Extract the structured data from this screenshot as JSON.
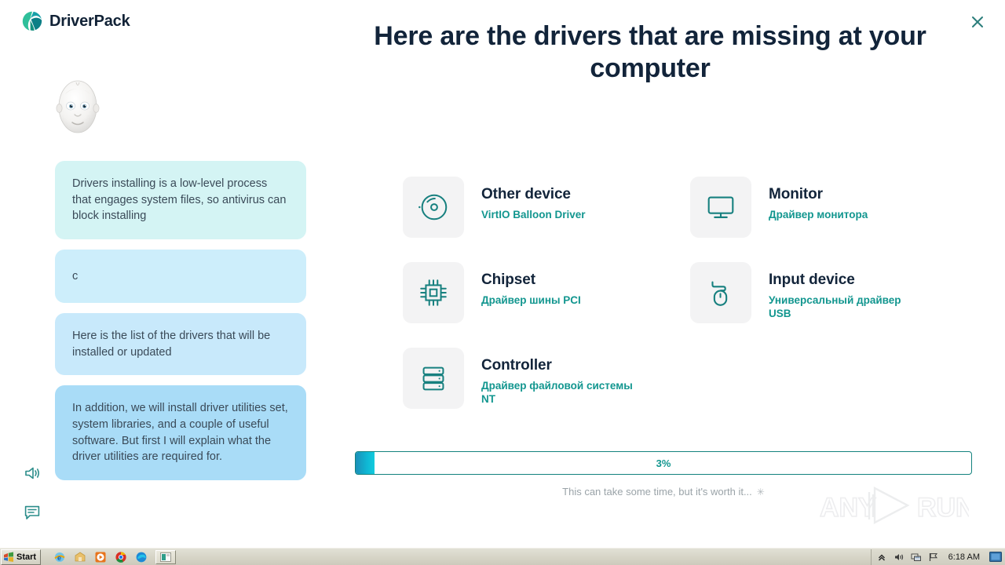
{
  "brand": {
    "name": "DriverPack",
    "logo_icon": "driverpack-logo-icon"
  },
  "window": {
    "close_label": "close-icon"
  },
  "assistant": {
    "avatar_icon": "assistant-avatar",
    "messages": [
      "Drivers installing is a low-level process that engages system files, so antivirus can block installing",
      "c",
      "Here is the list of the drivers that will be installed or updated",
      "In addition, we will install driver utilities set, system libraries, and a couple of useful software. But first I will explain what the driver utilities are required for."
    ]
  },
  "left_controls": [
    {
      "name": "sound-toggle",
      "icon": "speaker-icon"
    },
    {
      "name": "chat-toggle",
      "icon": "chat-bubble-icon"
    }
  ],
  "main": {
    "headline": "Here are the drivers that are missing at your computer",
    "drivers": [
      {
        "icon": "disc-icon",
        "title": "Other device",
        "subtitle": "VirtIO Balloon Driver"
      },
      {
        "icon": "monitor-icon",
        "title": "Monitor",
        "subtitle": "Драйвер монитора"
      },
      {
        "icon": "chip-icon",
        "title": "Chipset",
        "subtitle": "Драйвер шины PCI"
      },
      {
        "icon": "mouse-icon",
        "title": "Input device",
        "subtitle": "Универсальный драйвер USB"
      },
      {
        "icon": "server-icon",
        "title": "Controller",
        "subtitle": "Драйвер файловой системы NT"
      }
    ],
    "progress": {
      "percent": 3,
      "label": "3%",
      "note": "This can take some time, but it's worth it..."
    }
  },
  "watermark": {
    "text_left": "ANY",
    "text_right": "RUN"
  },
  "taskbar": {
    "start_label": "Start",
    "quick_launch": [
      {
        "name": "internet-explorer-icon"
      },
      {
        "name": "show-desktop-icon"
      },
      {
        "name": "media-player-icon"
      },
      {
        "name": "chrome-icon"
      },
      {
        "name": "edge-icon"
      }
    ],
    "task_buttons": [
      {
        "name": "driverpack-task-button"
      }
    ],
    "tray": {
      "icons": [
        {
          "name": "show-hidden-icons-icon"
        },
        {
          "name": "volume-icon"
        },
        {
          "name": "network-icon"
        },
        {
          "name": "flag-icon"
        }
      ],
      "clock": "6:18 AM",
      "desktop_icon": "desktop-preview-icon"
    }
  },
  "colors": {
    "accent_teal": "#12968f",
    "headline": "#12243a",
    "progress_fill_start": "#1b8fb8",
    "progress_fill_end": "#12cbdd",
    "bubble_1": "#d4f4f4",
    "bubble_2": "#cdeefb",
    "bubble_3": "#c8e9fb",
    "bubble_4": "#a9dcf7"
  }
}
